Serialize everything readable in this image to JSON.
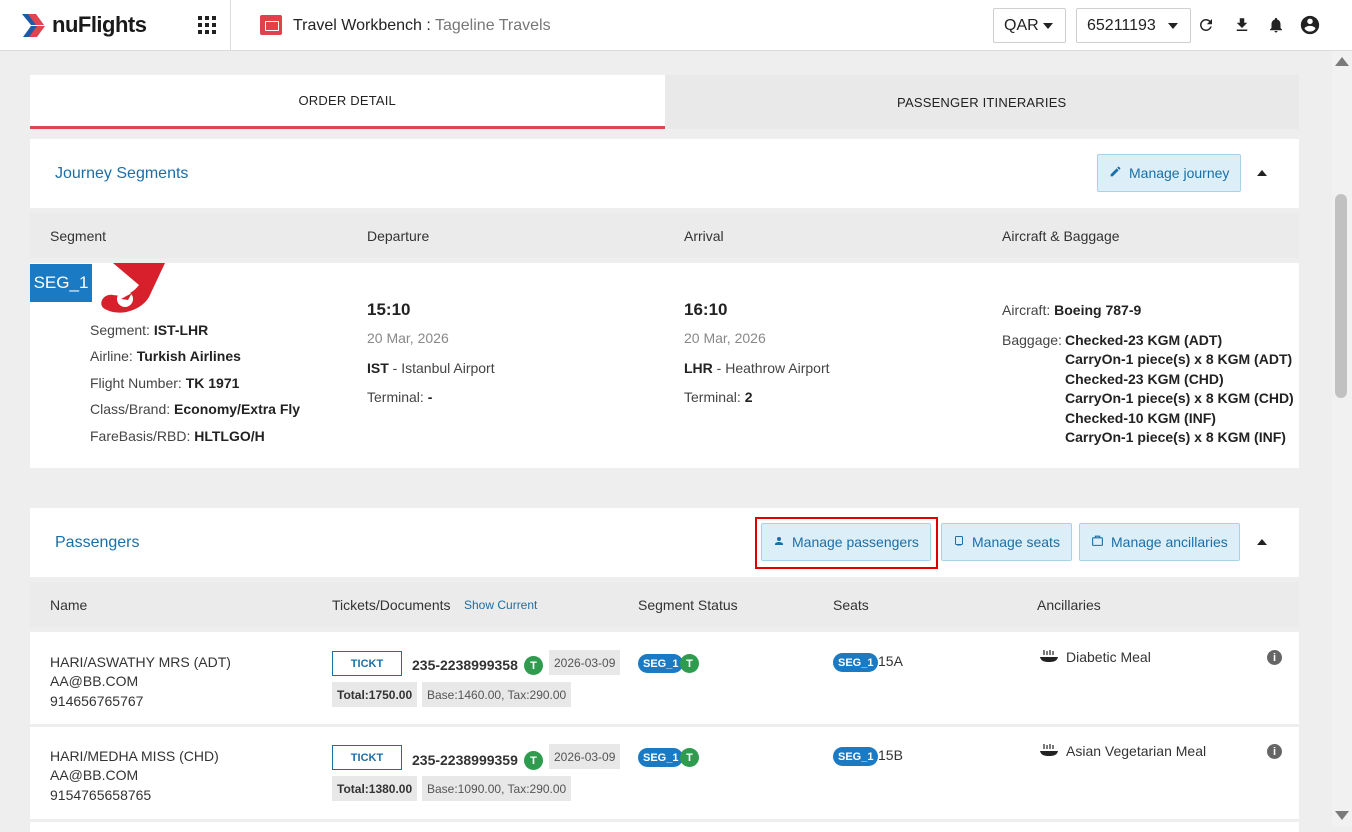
{
  "header": {
    "logo_text": "nuFlights",
    "app_title": "Travel Workbench",
    "app_subtitle": "Tageline Travels",
    "currency": "QAR",
    "account": "65211193"
  },
  "tabs": [
    {
      "label": "ORDER DETAIL",
      "active": true
    },
    {
      "label": "PASSENGER ITINERARIES",
      "active": false
    }
  ],
  "journey": {
    "title": "Journey Segments",
    "manage_label": "Manage journey",
    "columns": [
      "Segment",
      "Departure",
      "Arrival",
      "Aircraft & Baggage"
    ],
    "segment": {
      "id": "SEG_1",
      "segment_label": "Segment:",
      "segment": "IST-LHR",
      "airline_label": "Airline:",
      "airline": "Turkish Airlines",
      "flight_label": "Flight Number:",
      "flight": "TK 1971",
      "class_label": "Class/Brand:",
      "class": "Economy/Extra Fly",
      "fare_label": "FareBasis/RBD:",
      "fare": "HLTLGO/H",
      "dep_time": "15:10",
      "dep_date": "20 Mar, 2026",
      "dep_code": "IST",
      "dep_airport": " - Istanbul Airport",
      "dep_terminal_label": "Terminal:",
      "dep_terminal": "-",
      "arr_time": "16:10",
      "arr_date": "20 Mar, 2026",
      "arr_code": "LHR",
      "arr_airport": " - Heathrow Airport",
      "arr_terminal_label": "Terminal:",
      "arr_terminal": "2",
      "aircraft_label": "Aircraft:",
      "aircraft": "Boeing 787-9",
      "baggage_label": "Baggage:",
      "baggage": [
        "Checked-23 KGM (ADT)",
        "CarryOn-1 piece(s) x 8 KGM (ADT)",
        "Checked-23 KGM (CHD)",
        "CarryOn-1 piece(s) x 8 KGM (CHD)",
        "Checked-10 KGM (INF)",
        "CarryOn-1 piece(s) x 8 KGM (INF)"
      ]
    }
  },
  "passengers": {
    "title": "Passengers",
    "manage_passengers": "Manage passengers",
    "manage_seats": "Manage seats",
    "manage_ancillaries": "Manage ancillaries",
    "columns": {
      "name": "Name",
      "tickets": "Tickets/Documents",
      "show_current": "Show Current",
      "status": "Segment Status",
      "seats": "Seats",
      "ancillaries": "Ancillaries"
    },
    "rows": [
      {
        "name": "HARI/ASWATHY MRS (ADT)",
        "email": "AA@BB.COM",
        "phone": "914656765767",
        "ticket_btn": "TICKT",
        "ticket": "235-2238999358",
        "status_letter": "T",
        "date": "2026-03-09",
        "total": "Total:1750.00",
        "base_tax": "Base:1460.00, Tax:290.00",
        "seg": "SEG_1",
        "seat": "15A",
        "ancillary": "Diabetic Meal"
      },
      {
        "name": "HARI/MEDHA MISS (CHD)",
        "email": "AA@BB.COM",
        "phone": "9154765658765",
        "ticket_btn": "TICKT",
        "ticket": "235-2238999359",
        "status_letter": "T",
        "date": "2026-03-09",
        "total": "Total:1380.00",
        "base_tax": "Base:1090.00, Tax:290.00",
        "seg": "SEG_1",
        "seat": "15B",
        "ancillary": "Asian Vegetarian Meal"
      }
    ]
  },
  "colors": {
    "accent": "#1a6fa8",
    "brand_red": "#e0454f",
    "seg_blue": "#1a7ac4",
    "status_green": "#2e9b4e"
  }
}
